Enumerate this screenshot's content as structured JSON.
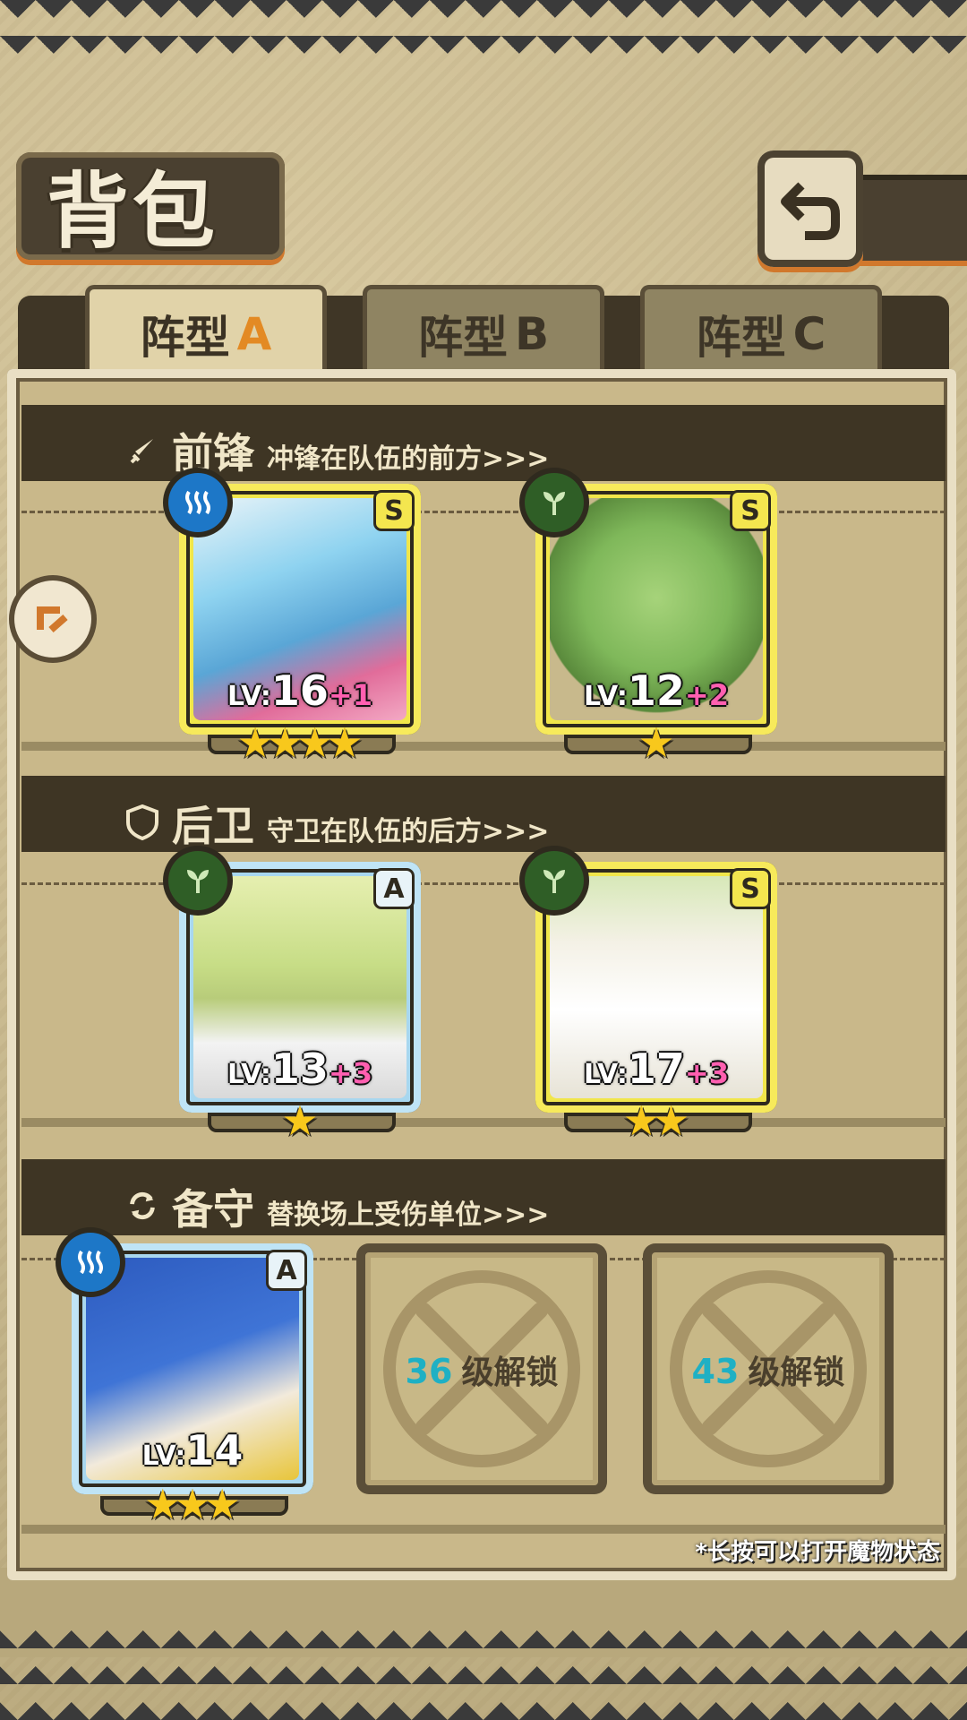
{
  "header": {
    "title": "背包",
    "back_icon": "back-arrow-icon"
  },
  "tabs": [
    {
      "prefix": "阵型",
      "letter": "A",
      "active": true
    },
    {
      "prefix": "阵型",
      "letter": "B",
      "active": false
    },
    {
      "prefix": "阵型",
      "letter": "C",
      "active": false
    }
  ],
  "sections": {
    "front": {
      "name": "前锋",
      "desc": "冲锋在队伍的前方>>>",
      "icon": "sword-icon"
    },
    "back": {
      "name": "后卫",
      "desc": "守卫在队伍的后方>>>",
      "icon": "shield-icon"
    },
    "reserve": {
      "name": "备守",
      "desc": "替换场上受伤单位>>>",
      "icon": "swap-icon"
    }
  },
  "units": {
    "front_1": {
      "element": "water",
      "rank": "S",
      "lv_label": "LV:",
      "level": "16",
      "plus": "+1",
      "stars": 4
    },
    "front_2": {
      "element": "grass",
      "rank": "S",
      "lv_label": "LV:",
      "level": "12",
      "plus": "+2",
      "stars": 1
    },
    "back_1": {
      "element": "grass",
      "rank": "A",
      "lv_label": "LV:",
      "level": "13",
      "plus": "+3",
      "stars": 1
    },
    "back_2": {
      "element": "grass",
      "rank": "S",
      "lv_label": "LV:",
      "level": "17",
      "plus": "+3",
      "stars": 2
    },
    "reserve_1": {
      "element": "water",
      "rank": "A",
      "lv_label": "LV:",
      "level": "14",
      "plus": "",
      "stars": 3
    }
  },
  "locked_slots": [
    {
      "level": "36",
      "label": "级解锁"
    },
    {
      "level": "43",
      "label": "级解锁"
    }
  ],
  "footnote": "*长按可以打开魔物状态",
  "colors": {
    "accent_orange": "#e38a24",
    "plus_pink": "#ff5fb0",
    "lock_cyan": "#1fb0c4",
    "star": "#f8c81c"
  }
}
